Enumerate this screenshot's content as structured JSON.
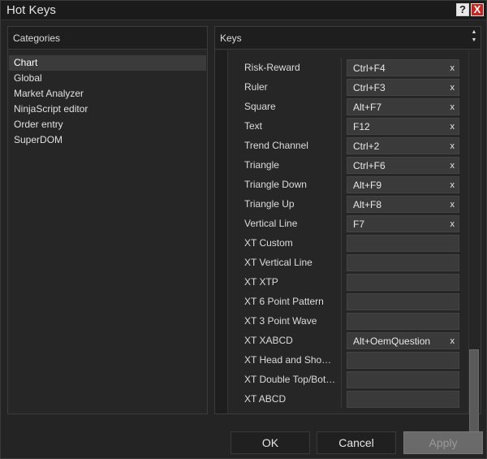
{
  "window": {
    "title": "Hot Keys",
    "help_label": "?",
    "close_label": "X"
  },
  "categories": {
    "header": "Categories",
    "items": [
      {
        "label": "Chart",
        "selected": true
      },
      {
        "label": "Global"
      },
      {
        "label": "Market Analyzer"
      },
      {
        "label": "NinjaScript editor"
      },
      {
        "label": "Order entry"
      },
      {
        "label": "SuperDOM"
      }
    ]
  },
  "keys": {
    "header": "Keys",
    "clear_label": "x",
    "rows": [
      {
        "name": "Risk-Reward",
        "key": "Ctrl+F4"
      },
      {
        "name": "Ruler",
        "key": "Ctrl+F3"
      },
      {
        "name": "Square",
        "key": "Alt+F7"
      },
      {
        "name": "Text",
        "key": "F12"
      },
      {
        "name": "Trend Channel",
        "key": "Ctrl+2"
      },
      {
        "name": "Triangle",
        "key": "Ctrl+F6"
      },
      {
        "name": "Triangle Down",
        "key": "Alt+F9"
      },
      {
        "name": "Triangle Up",
        "key": "Alt+F8"
      },
      {
        "name": "Vertical Line",
        "key": "F7"
      },
      {
        "name": "XT Custom",
        "key": ""
      },
      {
        "name": "XT Vertical Line",
        "key": ""
      },
      {
        "name": "XT XTP",
        "key": ""
      },
      {
        "name": "XT 6 Point Pattern",
        "key": ""
      },
      {
        "name": "XT 3 Point Wave",
        "key": ""
      },
      {
        "name": "XT XABCD",
        "key": "Alt+OemQuestion"
      },
      {
        "name": "XT Head and Sho…",
        "key": ""
      },
      {
        "name": "XT Double Top/Bot…",
        "key": ""
      },
      {
        "name": "XT ABCD",
        "key": ""
      }
    ]
  },
  "buttons": {
    "ok": "OK",
    "cancel": "Cancel",
    "apply": "Apply"
  }
}
